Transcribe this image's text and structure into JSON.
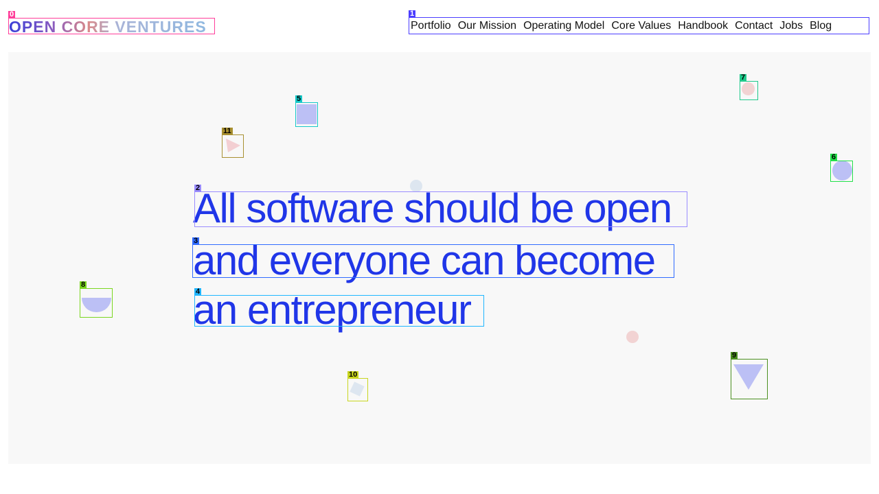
{
  "logo": {
    "text": "OPEN CORE VENTURES"
  },
  "nav": {
    "items": [
      "Portfolio",
      "Our Mission",
      "Operating Model",
      "Core Values",
      "Handbook",
      "Contact",
      "Jobs",
      "Blog"
    ]
  },
  "hero": {
    "lines": [
      "All software should be open",
      "and everyone can become",
      "an entrepreneur"
    ],
    "color": "#2036e8"
  },
  "marks": [
    {
      "id": "0",
      "color": "#ff3d9a"
    },
    {
      "id": "1",
      "color": "#4b3dff"
    },
    {
      "id": "2",
      "color": "#9a8cff"
    },
    {
      "id": "3",
      "color": "#2f6bff"
    },
    {
      "id": "4",
      "color": "#1fb6ff"
    },
    {
      "id": "5",
      "color": "#15c8c8"
    },
    {
      "id": "6",
      "color": "#22e04a"
    },
    {
      "id": "7",
      "color": "#1fc98a"
    },
    {
      "id": "8",
      "color": "#7ad61f"
    },
    {
      "id": "9",
      "color": "#4a8f1f"
    },
    {
      "id": "10",
      "color": "#c8d61f"
    },
    {
      "id": "11",
      "color": "#a89030"
    }
  ]
}
